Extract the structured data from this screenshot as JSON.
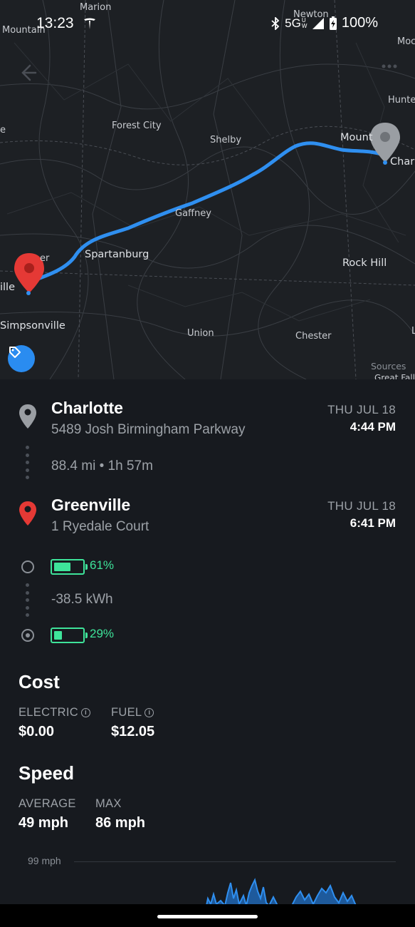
{
  "status_bar": {
    "time": "13:23",
    "network": "5G",
    "network_sub": "UW",
    "battery": "100%"
  },
  "map": {
    "labels": {
      "marion": "Marion",
      "mountain": "Mountain",
      "newton": "Newton",
      "moc": "Moc",
      "hunter": "Hunte",
      "forest_city": "Forest City",
      "shelby": "Shelby",
      "mount": "Mount",
      "charl": "Charl",
      "gaffney": "Gaffney",
      "spartanburg": "Spartanburg",
      "er": "er",
      "ville": "ille",
      "rock_hill": "Rock Hill",
      "simpsonville": "Simpsonville",
      "union": "Union",
      "chester": "Chester",
      "e": "e",
      "l": "L",
      "sources": "Sources",
      "great_falls": "Great Fall"
    },
    "route_color": "#2f8ff0",
    "start_pin_color": "#9a9ea3",
    "end_pin_color": "#e53935"
  },
  "trip": {
    "origin": {
      "name": "Charlotte",
      "address": "5489 Josh Birmingham Parkway",
      "date": "THU JUL 18",
      "time": "4:44 PM"
    },
    "summary": "88.4 mi • 1h 57m",
    "destination": {
      "name": "Greenville",
      "address": "1 Ryedale Court",
      "date": "THU JUL 18",
      "time": "6:41 PM"
    },
    "battery_start": {
      "percent_label": "61%",
      "level": 0.61
    },
    "energy_used": "-38.5 kWh",
    "battery_end": {
      "percent_label": "29%",
      "level": 0.29
    },
    "battery_color": "#3ee39a"
  },
  "cost": {
    "title": "Cost",
    "electric_label": "ELECTRIC",
    "electric_value": "$0.00",
    "fuel_label": "FUEL",
    "fuel_value": "$12.05"
  },
  "speed": {
    "title": "Speed",
    "average_label": "AVERAGE",
    "average_value": "49 mph",
    "max_label": "MAX",
    "max_value": "86 mph",
    "chart_top_label": "99 mph"
  }
}
